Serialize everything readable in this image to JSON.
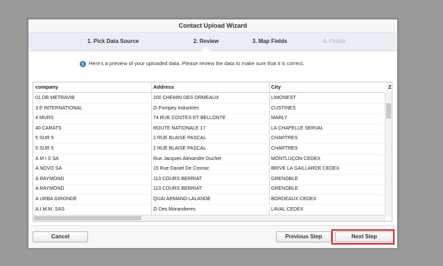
{
  "window": {
    "title": "Contact Upload Wizard"
  },
  "steps": [
    {
      "label": "1. Pick Data Source",
      "state": "done"
    },
    {
      "label": "2. Review",
      "state": "current"
    },
    {
      "label": "3. Map Fields",
      "state": "pending"
    },
    {
      "label": "4. Finish",
      "state": "disabled"
    }
  ],
  "info": {
    "icon": "info-icon",
    "text": "Here's a preview of your uploaded data. Please review the data to make sure that it is correct."
  },
  "table": {
    "headers": [
      "company",
      "Address",
      "City",
      "Z"
    ],
    "rows": [
      [
        "01 DB METRAVIB",
        "200 CHEMIN DES ORMEAUX",
        "LIMONEST"
      ],
      [
        "3 E INTERNATIONAL",
        "Zi Pompey Industries",
        "CUSTINES"
      ],
      [
        "4 MURS",
        "74 RUE COSTES ET BELLONTE",
        "MARLY"
      ],
      [
        "40 CARATS",
        "ROUTE NATIONALE 17",
        "LA CHAPELLE SERVAL"
      ],
      [
        "5 SUR 5",
        "2 RUE BLAISE PASCAL",
        "CHARTRES"
      ],
      [
        "5 SUR 5",
        "2 RUE BLAISE PASCAL",
        "CHARTRES"
      ],
      [
        "A M I S SA",
        "Rue Jacques Alexandre Duchet",
        "MONTLUÇON CEDEX"
      ],
      [
        "A NOVO SA",
        "15 Rue Daniel De Cosnac",
        "BRIVE LA GAILLARDE CEDEX"
      ],
      [
        "A RAYMOND",
        "113 COURS BERRIAT",
        "GRENOBLE"
      ],
      [
        "A RAYMOND",
        "113 COURS BERRIAT",
        "GRENOBLE"
      ],
      [
        "A URBA GIRONDE",
        "QUAI ARMAND LALANDE",
        "BORDEAUX CEDEX"
      ],
      [
        "A.I.M.M. SAS",
        "Zi Des Morandieres",
        "LAVAL CEDEX"
      ]
    ]
  },
  "footer": {
    "cancel_label": "Cancel",
    "previous_label": "Previous Step",
    "next_label": "Next Step"
  },
  "colors": {
    "highlight": "#d81e2b",
    "info_icon": "#2f7bbf",
    "steps_bg": "#e8eef4"
  }
}
